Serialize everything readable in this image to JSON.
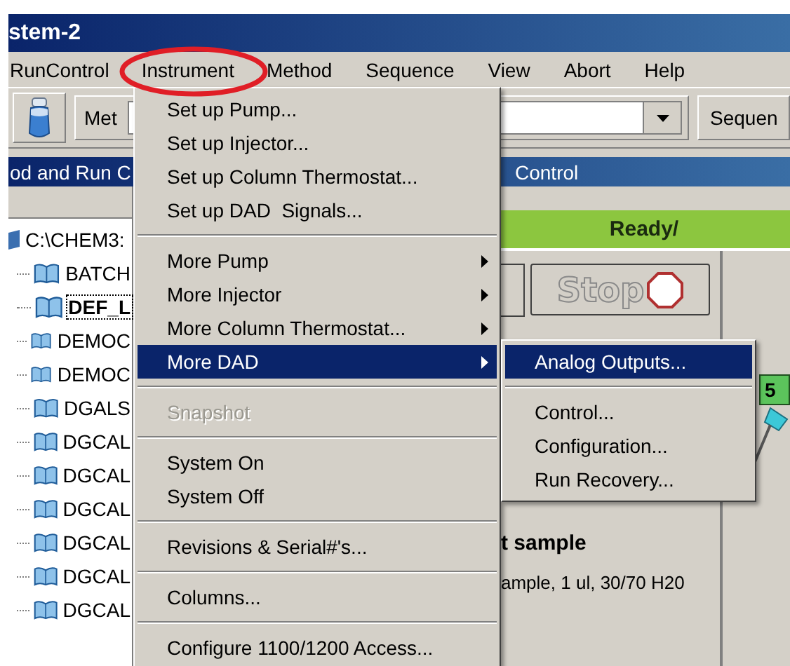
{
  "window": {
    "title": "stem-2"
  },
  "menubar": [
    {
      "label": "RunControl",
      "selected": false
    },
    {
      "label": "Instrument",
      "selected": true
    },
    {
      "label": "Method",
      "selected": false
    },
    {
      "label": "Sequence",
      "selected": false
    },
    {
      "label": "View",
      "selected": false
    },
    {
      "label": "Abort",
      "selected": false
    },
    {
      "label": "Help",
      "selected": false
    }
  ],
  "toolbar": {
    "method_label": "Met",
    "sequence_label": "Sequen"
  },
  "header": {
    "left": "od and Run C",
    "right": "Control"
  },
  "tree": {
    "label": "C:\\CHEM3:",
    "children": [
      {
        "label": "BATCH",
        "selected": false
      },
      {
        "label": "DEF_L",
        "selected": true
      },
      {
        "label": "DEMOC",
        "selected": false
      },
      {
        "label": "DEMOC",
        "selected": false
      },
      {
        "label": "DGALS",
        "selected": false
      },
      {
        "label": "DGCAL",
        "selected": false
      },
      {
        "label": "DGCAL",
        "selected": false
      },
      {
        "label": "DGCAL",
        "selected": false
      },
      {
        "label": "DGCAL",
        "selected": false
      },
      {
        "label": "DGCAL",
        "selected": false
      },
      {
        "label": "DGCAL",
        "selected": false
      }
    ]
  },
  "status": "Ready/",
  "stop_button": "Stop",
  "sample": {
    "title": "t sample",
    "detail": "ample, 1 ul, 30/70 H20"
  },
  "counter": "5",
  "menu": [
    {
      "kind": "item",
      "label": "Set up Pump...",
      "submenu": false,
      "selected": false,
      "disabled": false
    },
    {
      "kind": "item",
      "label": "Set up Injector...",
      "submenu": false,
      "selected": false,
      "disabled": false
    },
    {
      "kind": "item",
      "label": "Set up Column Thermostat...",
      "submenu": false,
      "selected": false,
      "disabled": false
    },
    {
      "kind": "item",
      "label": "Set up DAD  Signals...",
      "submenu": false,
      "selected": false,
      "disabled": false
    },
    {
      "kind": "separator"
    },
    {
      "kind": "item",
      "label": "More Pump",
      "submenu": true,
      "selected": false,
      "disabled": false
    },
    {
      "kind": "item",
      "label": "More Injector",
      "submenu": true,
      "selected": false,
      "disabled": false
    },
    {
      "kind": "item",
      "label": "More Column Thermostat...",
      "submenu": true,
      "selected": false,
      "disabled": false
    },
    {
      "kind": "item",
      "label": "More DAD",
      "submenu": true,
      "selected": true,
      "disabled": false
    },
    {
      "kind": "separator"
    },
    {
      "kind": "item",
      "label": "Snapshot",
      "submenu": false,
      "selected": false,
      "disabled": true
    },
    {
      "kind": "separator"
    },
    {
      "kind": "item",
      "label": "System On",
      "submenu": false,
      "selected": false,
      "disabled": false
    },
    {
      "kind": "item",
      "label": "System Off",
      "submenu": false,
      "selected": false,
      "disabled": false
    },
    {
      "kind": "separator"
    },
    {
      "kind": "item",
      "label": "Revisions & Serial#'s...",
      "submenu": false,
      "selected": false,
      "disabled": false
    },
    {
      "kind": "separator"
    },
    {
      "kind": "item",
      "label": "Columns...",
      "submenu": false,
      "selected": false,
      "disabled": false
    },
    {
      "kind": "separator"
    },
    {
      "kind": "item",
      "label": "Configure 1100/1200 Access...",
      "submenu": false,
      "selected": false,
      "disabled": false
    }
  ],
  "submenu": [
    {
      "kind": "item",
      "label": "Analog Outputs...",
      "submenu": false,
      "selected": true,
      "disabled": false
    },
    {
      "kind": "separator"
    },
    {
      "kind": "item",
      "label": "Control...",
      "submenu": false,
      "selected": false,
      "disabled": false
    },
    {
      "kind": "item",
      "label": "Configuration...",
      "submenu": false,
      "selected": false,
      "disabled": false
    },
    {
      "kind": "item",
      "label": "Run Recovery...",
      "submenu": false,
      "selected": false,
      "disabled": false
    }
  ]
}
